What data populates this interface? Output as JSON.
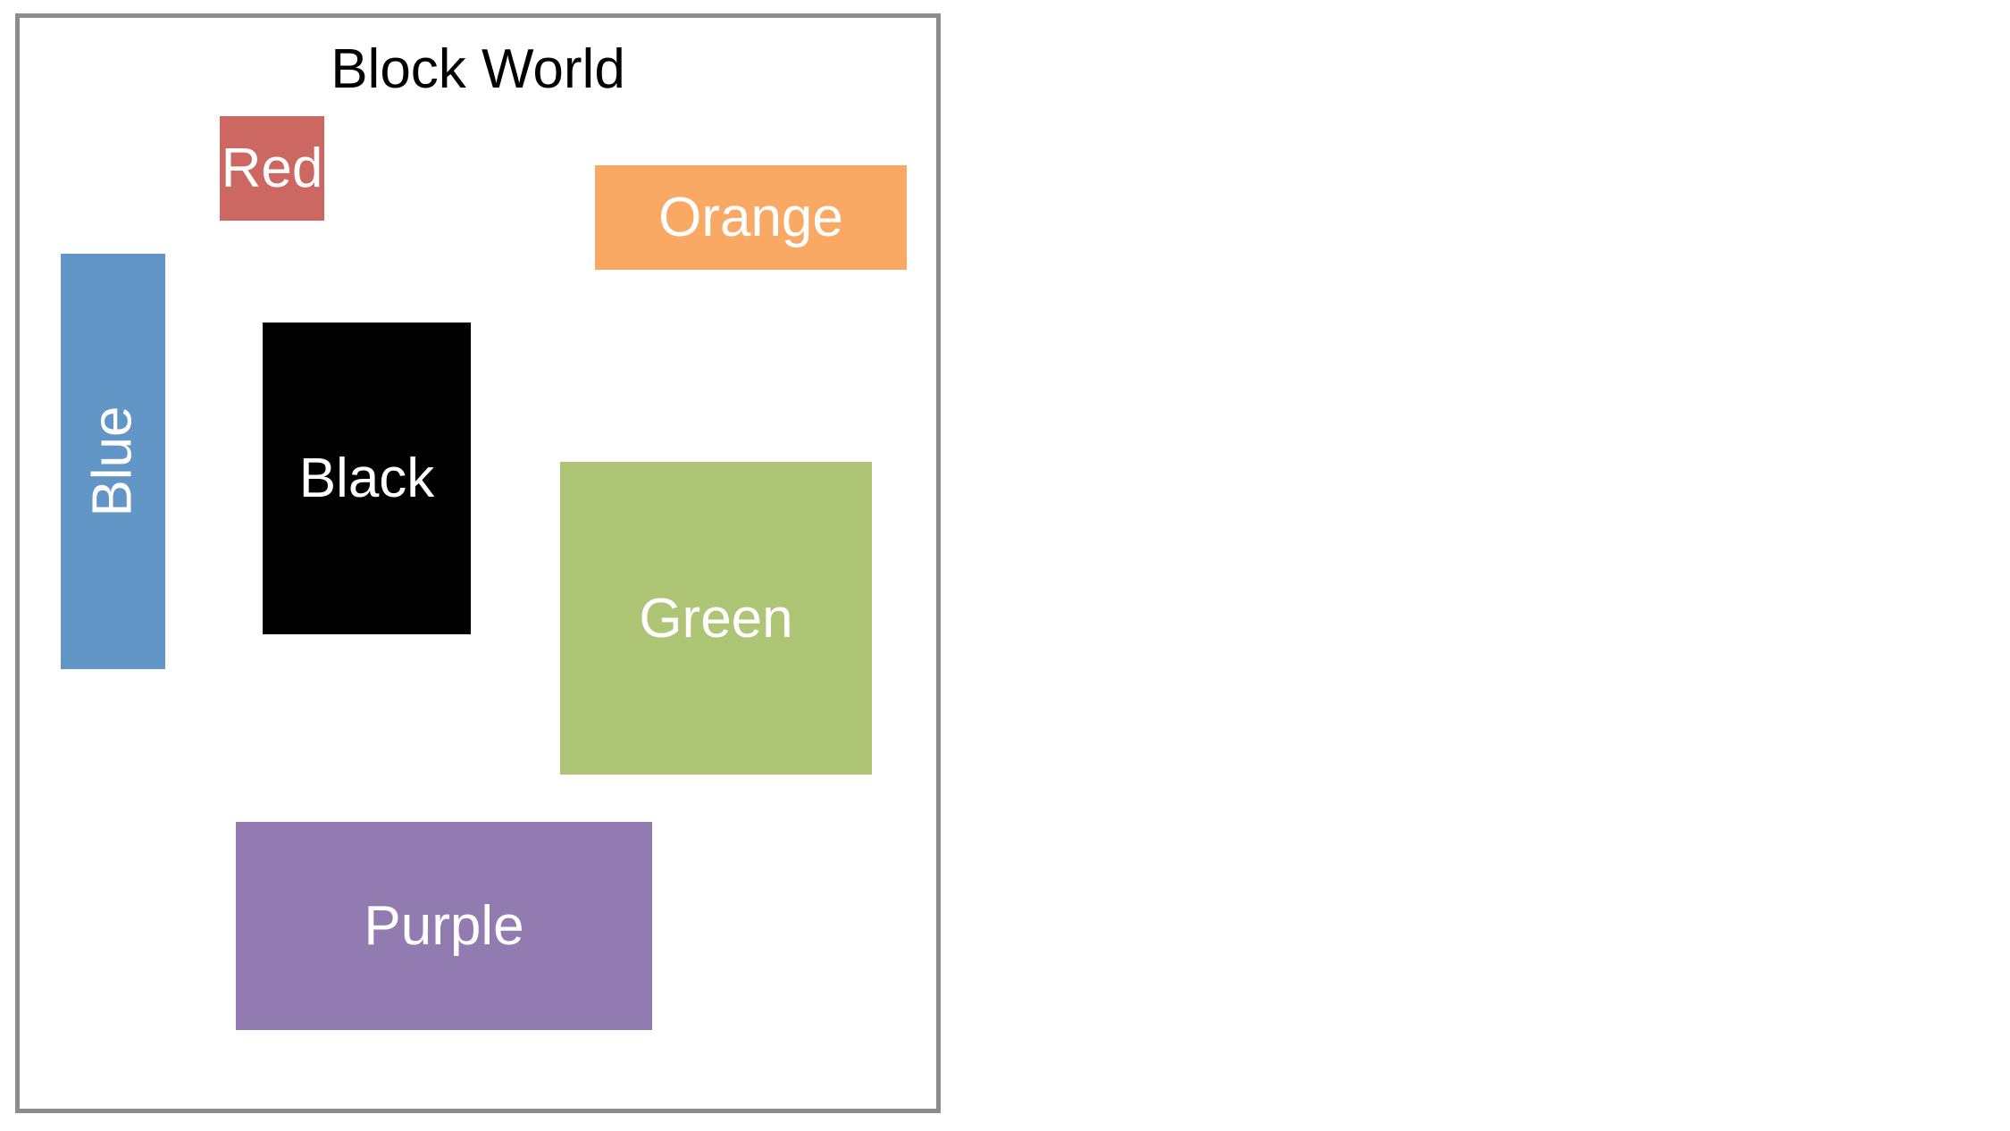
{
  "title": "Block World",
  "blocks": [
    {
      "id": "red",
      "label": "Red",
      "color": "#cd6762"
    },
    {
      "id": "orange",
      "label": "Orange",
      "color": "#f9a963"
    },
    {
      "id": "blue",
      "label": "Blue",
      "color": "#6196c7"
    },
    {
      "id": "black",
      "label": "Black",
      "color": "#000000"
    },
    {
      "id": "green",
      "label": "Green",
      "color": "#adc574"
    },
    {
      "id": "purple",
      "label": "Purple",
      "color": "#927bb1"
    }
  ]
}
